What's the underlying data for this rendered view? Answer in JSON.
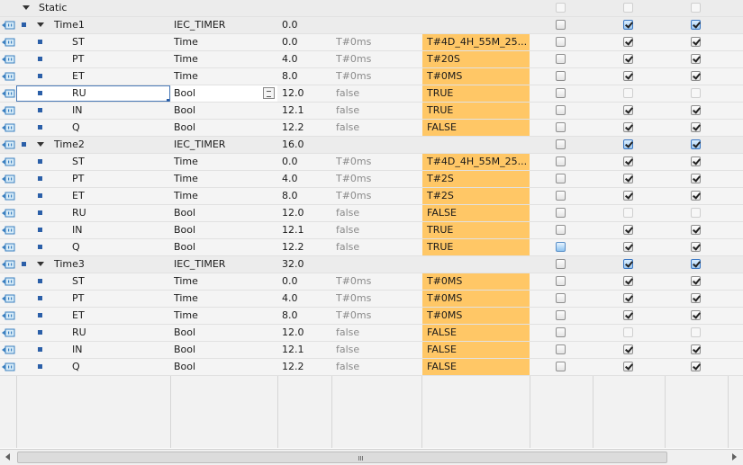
{
  "colors": {
    "monitor_bg": "#ffc766",
    "selection_border": "#4a7ab8",
    "checkbox_blue": "#9fc9f0"
  },
  "static_label": "Static",
  "rows": [
    {
      "kind": "group",
      "name": "Time1",
      "type": "IEC_TIMER",
      "offset": "0.0",
      "default": "",
      "monitor": "",
      "cb": [
        "plain",
        "blue",
        "blue"
      ]
    },
    {
      "kind": "sub",
      "name": "ST",
      "type": "Time",
      "offset": "0.0",
      "default": "T#0ms",
      "monitor": "T#4D_4H_55M_25...",
      "cb": [
        "plain",
        "checked",
        "checked"
      ]
    },
    {
      "kind": "sub",
      "name": "PT",
      "type": "Time",
      "offset": "4.0",
      "default": "T#0ms",
      "monitor": "T#20S",
      "cb": [
        "plain",
        "checked",
        "checked"
      ]
    },
    {
      "kind": "sub",
      "name": "ET",
      "type": "Time",
      "offset": "8.0",
      "default": "T#0ms",
      "monitor": "T#0MS",
      "cb": [
        "plain",
        "checked",
        "checked"
      ]
    },
    {
      "kind": "sub",
      "name": "RU",
      "type": "Bool",
      "offset": "12.0",
      "default": "false",
      "monitor": "TRUE",
      "cb": [
        "plain",
        "faint",
        "faint"
      ],
      "selected": true
    },
    {
      "kind": "sub",
      "name": "IN",
      "type": "Bool",
      "offset": "12.1",
      "default": "false",
      "monitor": "TRUE",
      "cb": [
        "plain",
        "checked",
        "checked"
      ]
    },
    {
      "kind": "sub",
      "name": "Q",
      "type": "Bool",
      "offset": "12.2",
      "default": "false",
      "monitor": "FALSE",
      "cb": [
        "plain",
        "checked",
        "checked"
      ]
    },
    {
      "kind": "group",
      "name": "Time2",
      "type": "IEC_TIMER",
      "offset": "16.0",
      "default": "",
      "monitor": "",
      "cb": [
        "plain",
        "blue",
        "blue"
      ]
    },
    {
      "kind": "sub",
      "name": "ST",
      "type": "Time",
      "offset": "0.0",
      "default": "T#0ms",
      "monitor": "T#4D_4H_55M_25...",
      "cb": [
        "plain",
        "checked",
        "checked"
      ]
    },
    {
      "kind": "sub",
      "name": "PT",
      "type": "Time",
      "offset": "4.0",
      "default": "T#0ms",
      "monitor": "T#2S",
      "cb": [
        "plain",
        "checked",
        "checked"
      ]
    },
    {
      "kind": "sub",
      "name": "ET",
      "type": "Time",
      "offset": "8.0",
      "default": "T#0ms",
      "monitor": "T#2S",
      "cb": [
        "plain",
        "checked",
        "checked"
      ]
    },
    {
      "kind": "sub",
      "name": "RU",
      "type": "Bool",
      "offset": "12.0",
      "default": "false",
      "monitor": "FALSE",
      "cb": [
        "plain",
        "faint",
        "faint"
      ]
    },
    {
      "kind": "sub",
      "name": "IN",
      "type": "Bool",
      "offset": "12.1",
      "default": "false",
      "monitor": "TRUE",
      "cb": [
        "plain",
        "checked",
        "checked"
      ]
    },
    {
      "kind": "sub",
      "name": "Q",
      "type": "Bool",
      "offset": "12.2",
      "default": "false",
      "monitor": "TRUE",
      "cb": [
        "half",
        "checked",
        "checked"
      ]
    },
    {
      "kind": "group",
      "name": "Time3",
      "type": "IEC_TIMER",
      "offset": "32.0",
      "default": "",
      "monitor": "",
      "cb": [
        "plain",
        "blue",
        "blue"
      ]
    },
    {
      "kind": "sub",
      "name": "ST",
      "type": "Time",
      "offset": "0.0",
      "default": "T#0ms",
      "monitor": "T#0MS",
      "cb": [
        "plain",
        "checked",
        "checked"
      ]
    },
    {
      "kind": "sub",
      "name": "PT",
      "type": "Time",
      "offset": "4.0",
      "default": "T#0ms",
      "monitor": "T#0MS",
      "cb": [
        "plain",
        "checked",
        "checked"
      ]
    },
    {
      "kind": "sub",
      "name": "ET",
      "type": "Time",
      "offset": "8.0",
      "default": "T#0ms",
      "monitor": "T#0MS",
      "cb": [
        "plain",
        "checked",
        "checked"
      ]
    },
    {
      "kind": "sub",
      "name": "RU",
      "type": "Bool",
      "offset": "12.0",
      "default": "false",
      "monitor": "FALSE",
      "cb": [
        "plain",
        "faint",
        "faint"
      ]
    },
    {
      "kind": "sub",
      "name": "IN",
      "type": "Bool",
      "offset": "12.1",
      "default": "false",
      "monitor": "FALSE",
      "cb": [
        "plain",
        "checked",
        "checked"
      ]
    },
    {
      "kind": "sub",
      "name": "Q",
      "type": "Bool",
      "offset": "12.2",
      "default": "false",
      "monitor": "FALSE",
      "cb": [
        "plain",
        "checked",
        "checked"
      ]
    }
  ]
}
